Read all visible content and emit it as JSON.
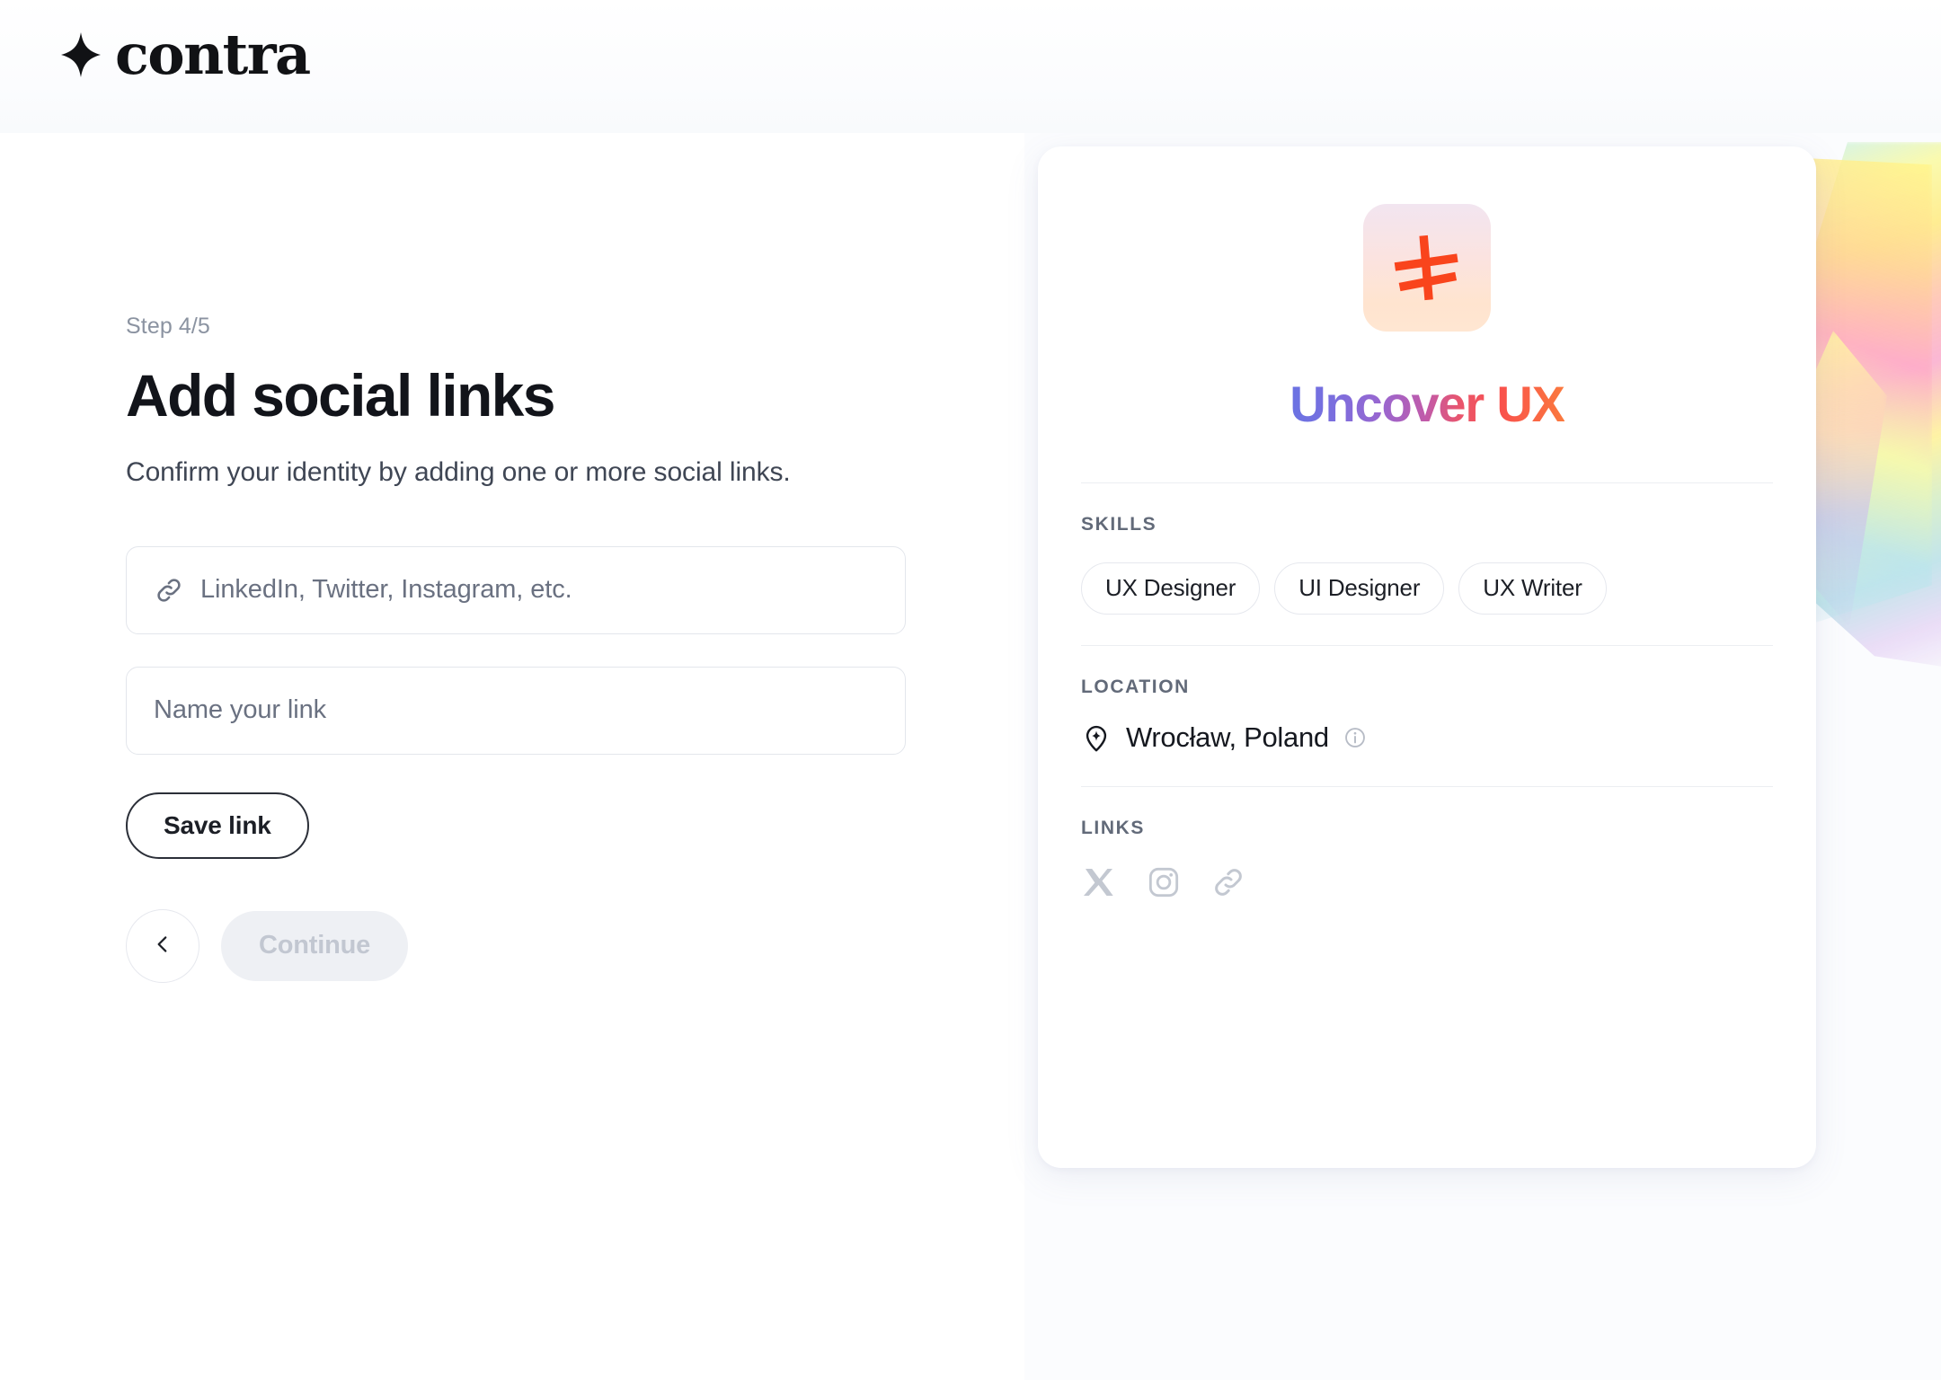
{
  "brand": {
    "name": "contra",
    "logo_icon": "contra-sparkle-icon"
  },
  "form": {
    "step": "Step 4/5",
    "title": "Add social links",
    "subtitle": "Confirm your identity by adding one or more social links.",
    "link_field": {
      "icon": "link-icon",
      "placeholder": "LinkedIn, Twitter, Instagram, etc.",
      "value": ""
    },
    "name_field": {
      "placeholder": "Name your link",
      "value": ""
    },
    "save_label": "Save link",
    "back_icon": "chevron-left-icon",
    "continue_label": "Continue"
  },
  "profile": {
    "logo_icon": "asterisk-icon",
    "name": "Uncover UX",
    "name_gradient_from": "#6a73e3",
    "name_gradient_to": "#fb7a3e",
    "skills": {
      "label": "SKILLS",
      "items": [
        "UX Designer",
        "UI Designer",
        "UX Writer"
      ]
    },
    "location": {
      "label": "LOCATION",
      "pin_icon": "location-pin-icon",
      "value": "Wrocław, Poland",
      "info_icon": "info-circle-icon"
    },
    "links": {
      "label": "LINKS",
      "items": [
        {
          "icon": "x-twitter-icon"
        },
        {
          "icon": "instagram-icon"
        },
        {
          "icon": "link-icon"
        }
      ]
    }
  },
  "colors": {
    "page_bg": "#ffffff",
    "header_bg": "#f8fafc",
    "card_bg": "#ffffff",
    "border": "#e3e6ec",
    "muted_text": "#6a7181",
    "accent_red": "#f9512a",
    "disabled_bg": "#eef0f4"
  }
}
